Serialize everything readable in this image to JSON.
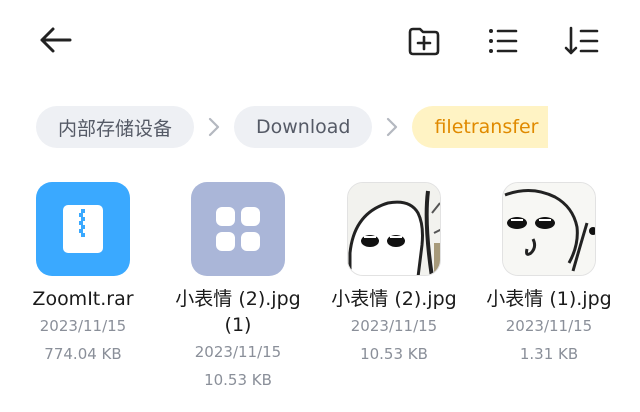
{
  "toolbar": {
    "back_icon": "back-arrow-icon",
    "new_folder_icon": "new-folder-icon",
    "list_view_icon": "list-view-icon",
    "sort_icon": "sort-icon",
    "icon_color": "#222222"
  },
  "breadcrumb": {
    "items": [
      {
        "label": "内部存储设备"
      },
      {
        "label": "Download"
      },
      {
        "label": "filetransfer"
      }
    ],
    "separator_icon": "chevron-right-icon",
    "active_color": "#e08a00"
  },
  "files": [
    {
      "name": "ZoomIt.rar",
      "date": "2023/11/15",
      "size": "774.04 KB",
      "icon": "archive-file-icon",
      "color": "#3aa9ff"
    },
    {
      "name": "小表情 (2).jpg (1)",
      "date": "2023/11/15",
      "size": "10.53 KB",
      "icon": "app-grid-icon",
      "color": "#aab6d8"
    },
    {
      "name": "小表情 (2).jpg",
      "date": "2023/11/15",
      "size": "10.53 KB",
      "icon": "image-thumbnail"
    },
    {
      "name": "小表情 (1).jpg",
      "date": "2023/11/15",
      "size": "1.31 KB",
      "icon": "image-thumbnail"
    }
  ]
}
